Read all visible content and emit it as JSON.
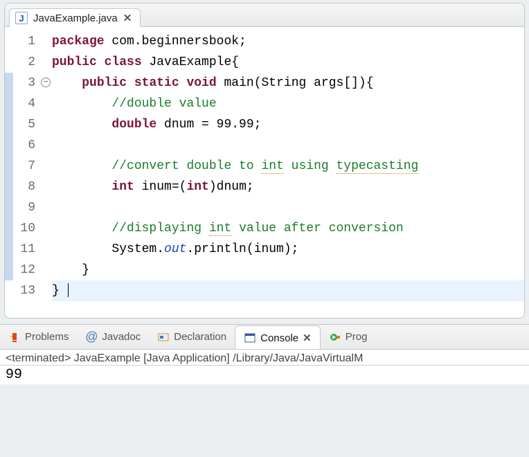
{
  "editor": {
    "tab": {
      "filename": "JavaExample.java"
    },
    "lines": [
      {
        "num": "1",
        "marker": "",
        "fold": "",
        "html": "<span class='kw'>package</span> com.beginnersbook;"
      },
      {
        "num": "2",
        "marker": "",
        "fold": "",
        "html": "<span class='kw'>public</span> <span class='kw'>class</span> JavaExample{"
      },
      {
        "num": "3",
        "marker": "blue",
        "fold": "minus",
        "html": "    <span class='kw'>public</span> <span class='kw'>static</span> <span class='kw'>void</span> main(String args[]){"
      },
      {
        "num": "4",
        "marker": "blue",
        "fold": "",
        "html": "        <span class='cmt'>//double value</span>"
      },
      {
        "num": "5",
        "marker": "blue",
        "fold": "",
        "html": "        <span class='kw'>double</span> dnum = 99.99;"
      },
      {
        "num": "6",
        "marker": "blue",
        "fold": "",
        "html": ""
      },
      {
        "num": "7",
        "marker": "blue",
        "fold": "",
        "html": "        <span class='cmt'>//convert double to <span class='underline-warn'>int</span> using <span class='underline-warn'>typecasting</span></span>"
      },
      {
        "num": "8",
        "marker": "blue",
        "fold": "",
        "html": "        <span class='kw'>int</span> inum=(<span class='kw'>int</span>)dnum;"
      },
      {
        "num": "9",
        "marker": "blue",
        "fold": "",
        "html": ""
      },
      {
        "num": "10",
        "marker": "blue",
        "fold": "",
        "html": "        <span class='cmt'>//displaying <span class='underline-warn'>int</span> value after conversion</span>"
      },
      {
        "num": "11",
        "marker": "blue",
        "fold": "",
        "html": "        System.<span class='static-ital'>out</span>.println(inum);"
      },
      {
        "num": "12",
        "marker": "blue",
        "fold": "",
        "html": "    }"
      },
      {
        "num": "13",
        "marker": "",
        "fold": "",
        "cur": true,
        "html": "} <span class='cursor'></span>"
      }
    ]
  },
  "views": {
    "tabs": [
      {
        "id": "problems",
        "label": "Problems",
        "icon": "warning"
      },
      {
        "id": "javadoc",
        "label": "Javadoc",
        "icon": "at"
      },
      {
        "id": "declaration",
        "label": "Declaration",
        "icon": "decl"
      },
      {
        "id": "console",
        "label": "Console",
        "icon": "console",
        "active": true,
        "closable": true
      },
      {
        "id": "progress",
        "label": "Prog",
        "icon": "run"
      }
    ]
  },
  "console": {
    "info": "<terminated> JavaExample [Java Application] /Library/Java/JavaVirtualM",
    "output": "99"
  }
}
